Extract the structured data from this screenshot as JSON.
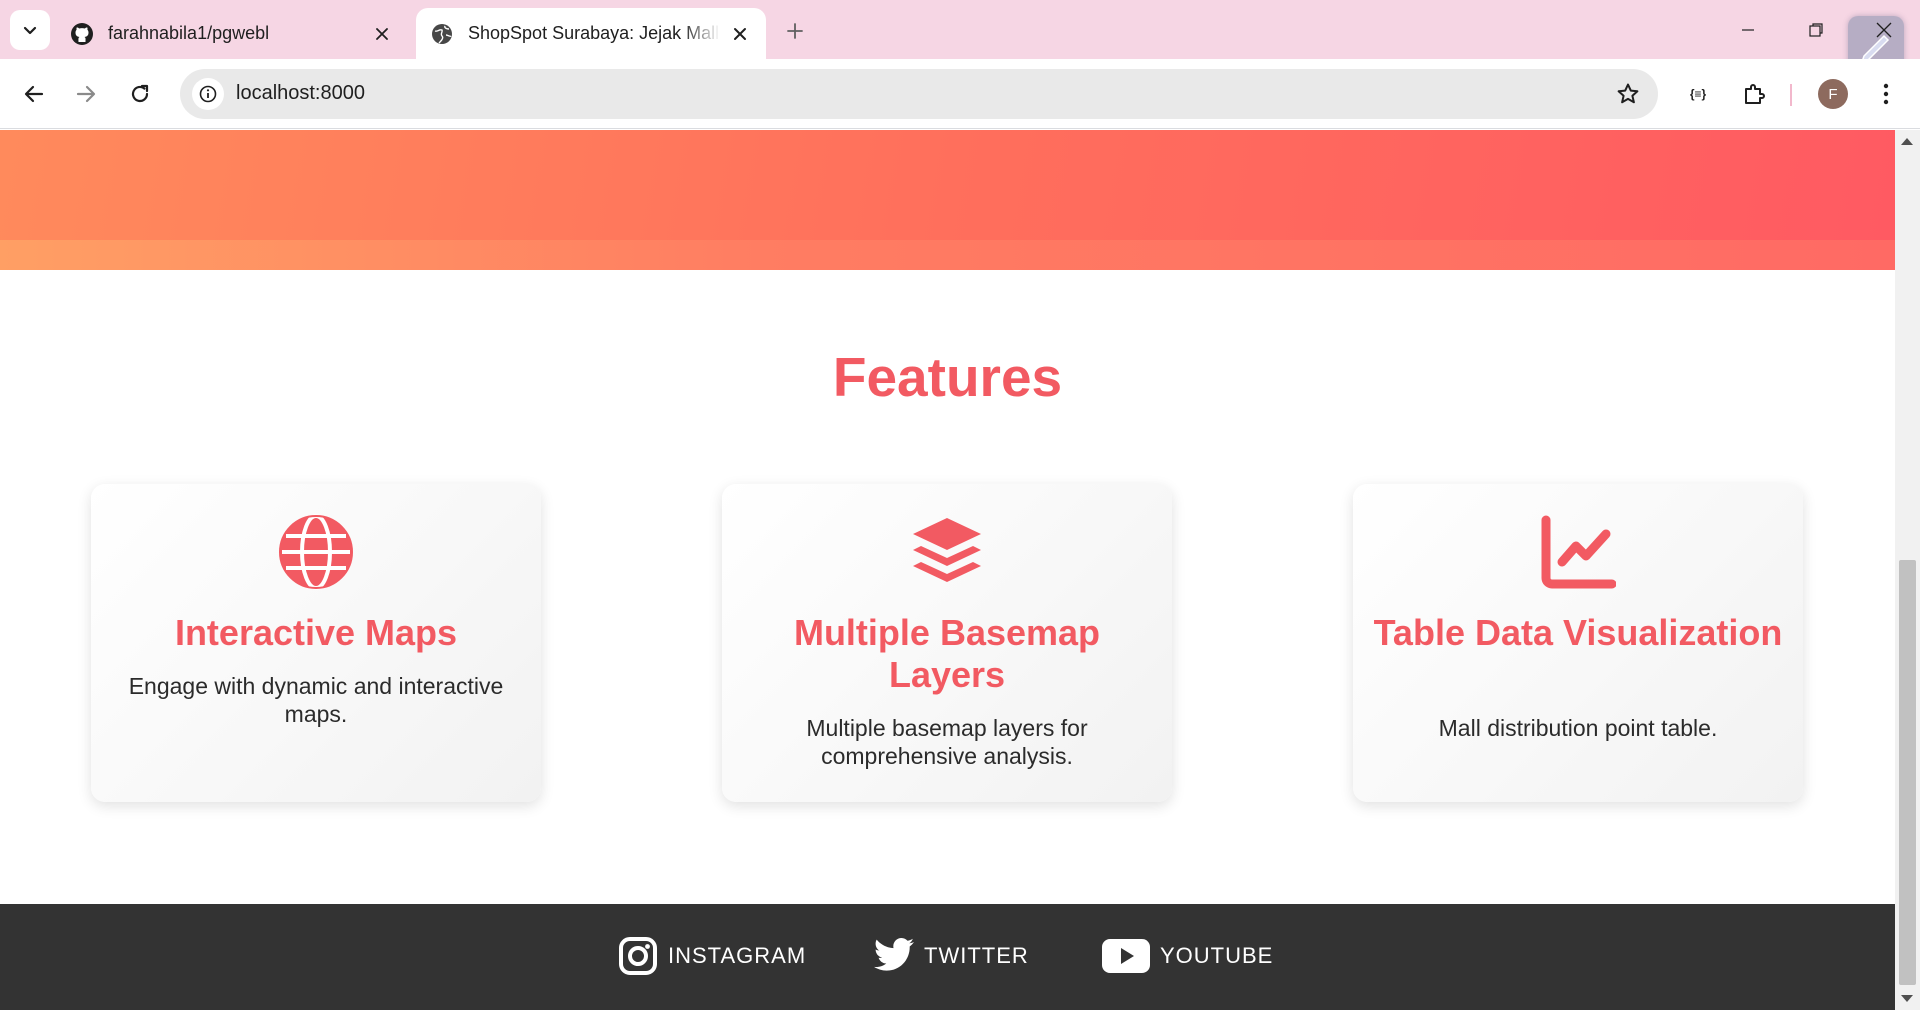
{
  "browser": {
    "tabs": [
      {
        "title": "farahnabila1/pgwebl",
        "favicon": "github-icon",
        "active": false
      },
      {
        "title": "ShopSpot Surabaya: Jejak Mall Kota",
        "favicon": "globe-icon",
        "active": true
      }
    ],
    "address_bar": {
      "url": "localhost:8000"
    },
    "profile_initial": "F"
  },
  "page": {
    "features": {
      "title": "Features",
      "cards": [
        {
          "icon": "globe-icon",
          "title": "Interactive Maps",
          "text": "Engage with dynamic and interactive maps."
        },
        {
          "icon": "layers-icon",
          "title": "Multiple Basemap Layers",
          "text": "Multiple basemap layers for comprehensive analysis."
        },
        {
          "icon": "chart-line-icon",
          "title": "Table Data Visualization",
          "text": "Mall distribution point table."
        }
      ]
    },
    "footer": {
      "links": [
        {
          "icon": "instagram-icon",
          "label": "INSTAGRAM"
        },
        {
          "icon": "twitter-icon",
          "label": "TWITTER"
        },
        {
          "icon": "youtube-icon",
          "label": "YOUTUBE"
        }
      ]
    },
    "colors": {
      "accent": "#f25a62",
      "hero_gradient_start": "#ff8a5c",
      "hero_gradient_end": "#ff5a62",
      "footer_bg": "#333333",
      "tabstrip_bg": "#f6d6e4"
    }
  }
}
